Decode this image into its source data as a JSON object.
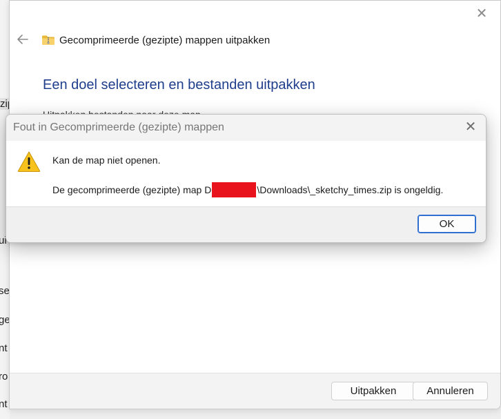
{
  "background_app": {
    "fragments": [
      "zip",
      "ui",
      "se",
      "ge",
      "nt",
      "ro",
      "nt"
    ]
  },
  "wizard": {
    "title": "Gecomprimeerde (gezipte) mappen uitpakken",
    "heading": "Een doel selecteren en bestanden uitpakken",
    "partial_text": "Uitpakken bestanden naar deze map",
    "close_glyph": "✕",
    "extract_label": "Uitpakken",
    "cancel_label": "Annuleren",
    "icons": {
      "back": "back-arrow-icon",
      "folder": "zip-folder-icon"
    }
  },
  "dialog": {
    "title": "Fout in Gecomprimeerde (gezipte) mappen",
    "close_glyph": "✕",
    "message_primary": "Kan de map niet openen.",
    "message_prefix": "De gecomprimeerde (gezipte) map D",
    "message_suffix": "\\Downloads\\_sketchy_times.zip is ongeldig.",
    "ok_label": "OK",
    "icons": {
      "warning": "warning-icon"
    },
    "colors": {
      "redaction": "#e8131d",
      "accent": "#2f6fd0",
      "heading": "#1e3d8c"
    }
  }
}
